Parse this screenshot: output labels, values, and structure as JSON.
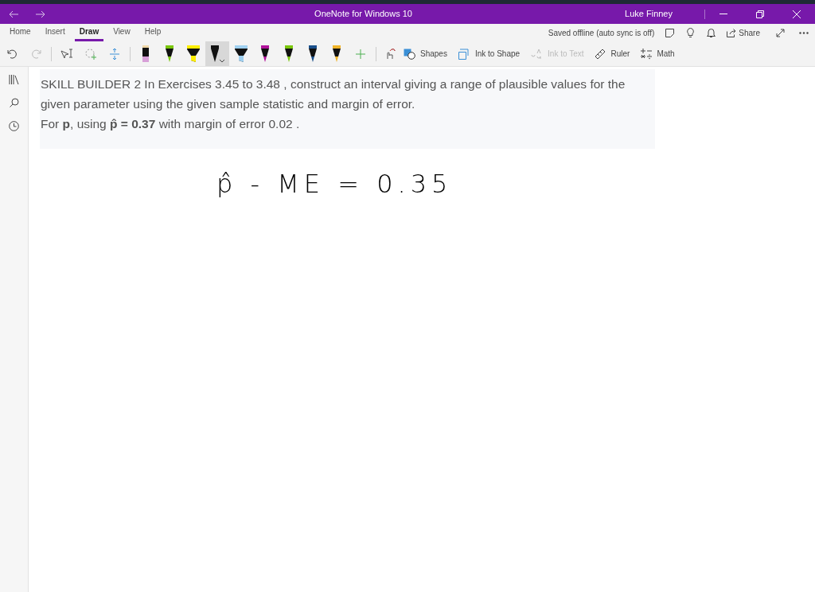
{
  "window": {
    "title": "OneNote for Windows 10",
    "user": "Luke Finney"
  },
  "ribbon_tabs": [
    {
      "label": "Home",
      "selected": false
    },
    {
      "label": "Insert",
      "selected": false
    },
    {
      "label": "Draw",
      "selected": true
    },
    {
      "label": "View",
      "selected": false
    },
    {
      "label": "Help",
      "selected": false
    }
  ],
  "sync_status": "Saved offline (auto sync is off)",
  "share_label": "Share",
  "pens": [
    {
      "kind": "eraser",
      "color": "#d8a0d8",
      "selected": false
    },
    {
      "kind": "pen",
      "color": "#7ac70c",
      "selected": false
    },
    {
      "kind": "highlighter",
      "color": "#ffee00",
      "selected": false
    },
    {
      "kind": "pen",
      "color": "#111111",
      "selected": true
    },
    {
      "kind": "highlighter",
      "color": "#9fd0f0",
      "selected": false
    },
    {
      "kind": "pen",
      "color": "#b0129a",
      "selected": false
    },
    {
      "kind": "pen",
      "color": "#7ac70c",
      "selected": false
    },
    {
      "kind": "pen",
      "color": "#1a4f8a",
      "selected": false
    },
    {
      "kind": "pen",
      "color": "#f0b429",
      "selected": false
    }
  ],
  "tools": [
    {
      "label": "Shapes",
      "disabled": false
    },
    {
      "label": "Ink to Shape",
      "disabled": false
    },
    {
      "label": "Ink to Text",
      "disabled": true
    },
    {
      "label": "Ruler",
      "disabled": false
    },
    {
      "label": "Math",
      "disabled": false
    }
  ],
  "question": [
    "SKILL BUILDER 2 In Exercises 3.45 to 3.48 , construct an interval giving a range of plausible values for the",
    "given parameter using the given sample statistic and margin of error.",
    "For **p**, using **p̂ = 0.37** with margin of error 0.02 ."
  ],
  "ink_note": "p̂ - ME = 0.35"
}
